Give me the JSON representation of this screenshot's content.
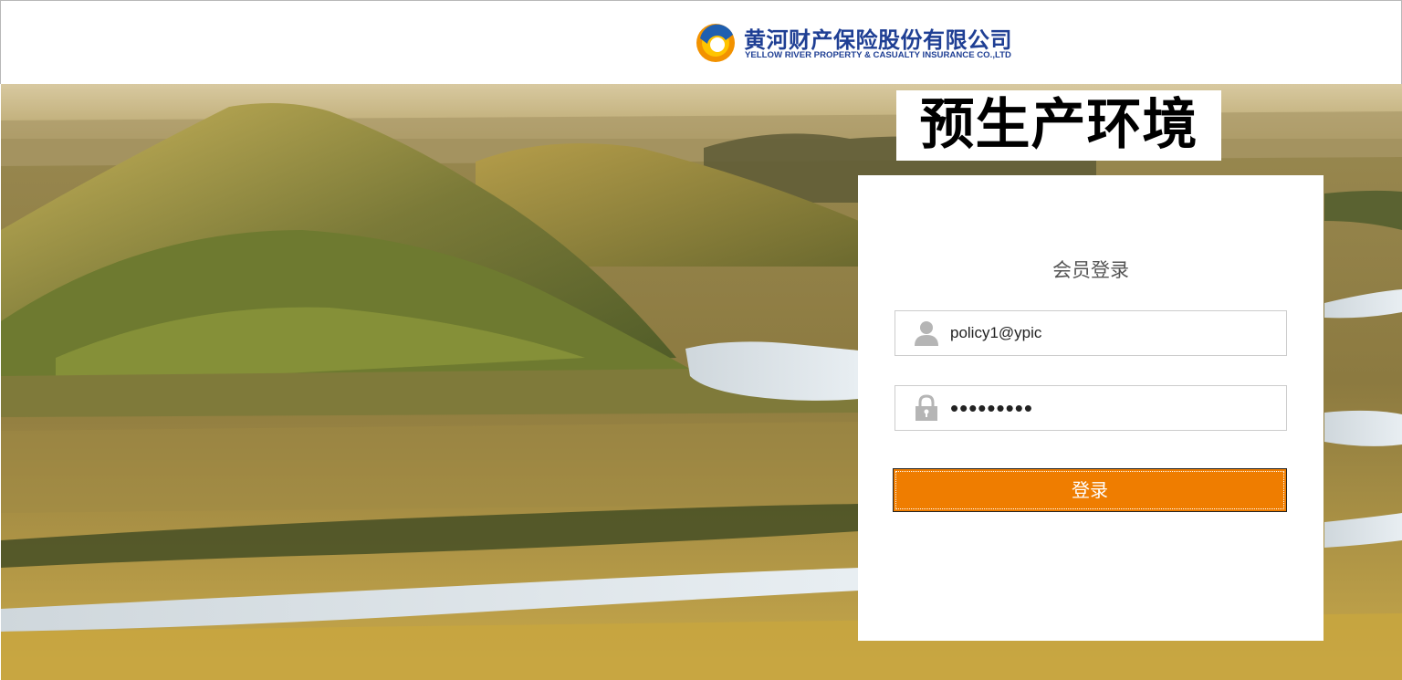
{
  "header": {
    "logo": {
      "name_cn": "黄河财产保险股份有限公司",
      "name_en": "YELLOW RIVER PROPERTY & CASUALTY INSURANCE CO.,LTD",
      "colors": {
        "text": "#1f3f94",
        "mark_blue": "#1f5fb0",
        "mark_orange": "#f29200",
        "mark_yellow": "#ffc400"
      }
    }
  },
  "banner": {
    "text": "预生产环境"
  },
  "login": {
    "title": "会员登录",
    "username": {
      "value": "policy1@ypic",
      "icon": "user-icon"
    },
    "password": {
      "value": "•••••••••",
      "icon": "lock-icon"
    },
    "submit_label": "登录",
    "colors": {
      "button": "#ef7d00"
    }
  },
  "background": {
    "description_icon": "landscape-image"
  }
}
